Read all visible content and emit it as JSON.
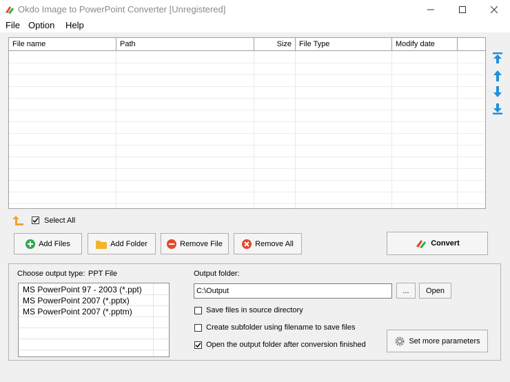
{
  "window": {
    "title": "Okdo Image to PowerPoint Converter [Unregistered]",
    "minimize_icon": "minimize-icon",
    "maximize_icon": "maximize-icon",
    "close_icon": "close-icon"
  },
  "menu": {
    "items": [
      "File",
      "Option",
      "Help"
    ]
  },
  "file_list": {
    "columns": [
      "File name",
      "Path",
      "Size",
      "File Type",
      "Modify date"
    ],
    "rows": []
  },
  "side_controls": {
    "icons": [
      "move-to-top-icon",
      "move-up-icon",
      "move-down-icon",
      "move-to-bottom-icon"
    ]
  },
  "select_all": {
    "label": "Select All",
    "checked": true
  },
  "toolbar": {
    "add_files": "Add Files",
    "add_folder": "Add Folder",
    "remove_file": "Remove File",
    "remove_all": "Remove All",
    "convert": "Convert"
  },
  "output_type": {
    "label": "Choose output type:",
    "selected": "PPT File",
    "options": [
      "MS PowerPoint 97 - 2003 (*.ppt)",
      "MS PowerPoint 2007 (*.pptx)",
      "MS PowerPoint 2007 (*.pptm)"
    ]
  },
  "output_folder": {
    "label": "Output folder:",
    "value": "C:\\Output",
    "browse_label": "...",
    "open_label": "Open"
  },
  "options": {
    "save_in_source": {
      "label": "Save files in source directory",
      "checked": false
    },
    "create_subfolder": {
      "label": "Create subfolder using filename to save files",
      "checked": false
    },
    "open_after": {
      "label": "Open the output folder after conversion finished",
      "checked": true
    }
  },
  "set_params": {
    "label": "Set more parameters"
  },
  "colors": {
    "accent_blue": "#1e8fdc",
    "add_green": "#2fa84f",
    "remove_red": "#e0492f",
    "folder_yellow": "#f3b52e"
  }
}
